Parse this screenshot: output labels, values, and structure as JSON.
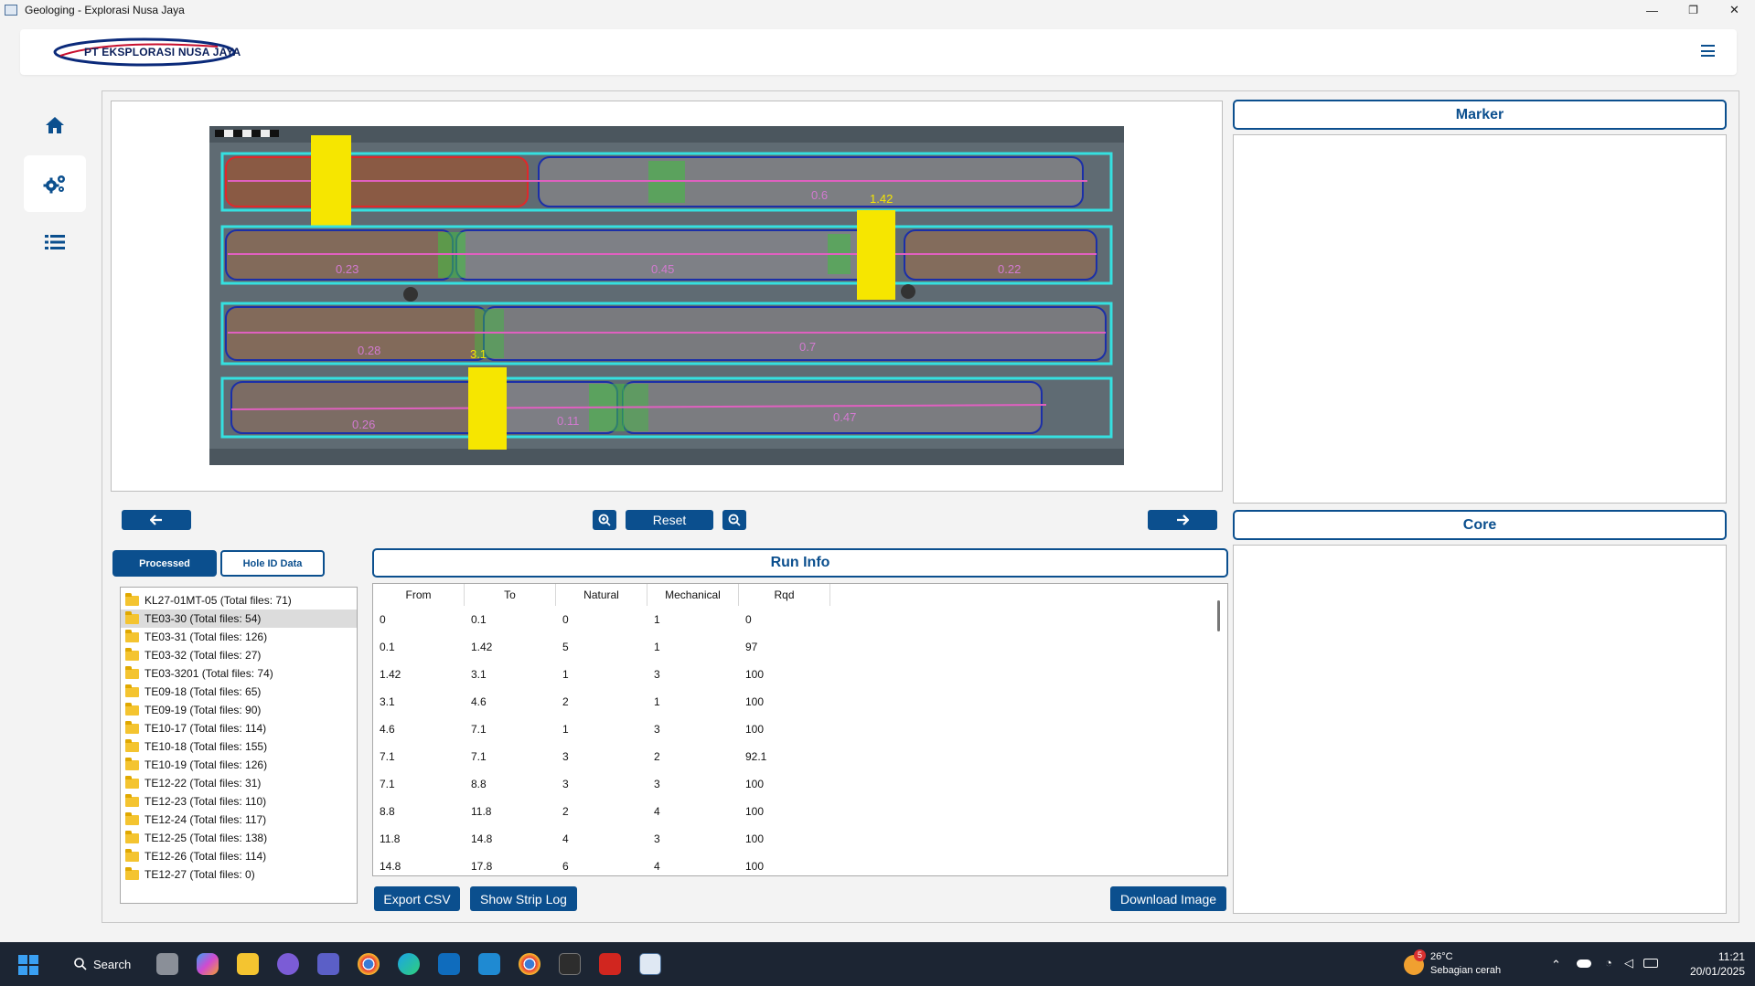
{
  "window": {
    "title": "Geologing - Explorasi Nusa Jaya",
    "minimize": "—",
    "restore": "❐",
    "close": "✕"
  },
  "header": {
    "logo_text": "PT EKSPLORASI NUSA JAYA",
    "menu_icon": "hamburger-icon"
  },
  "nav": {
    "items": [
      {
        "name": "home",
        "icon": "home-icon"
      },
      {
        "name": "settings",
        "icon": "gears-icon"
      },
      {
        "name": "list",
        "icon": "list-icon"
      }
    ],
    "active": "settings"
  },
  "core_image": {
    "labels": {
      "row1": [
        "0.6",
        "1.42"
      ],
      "row2": [
        "0.23",
        "0.45",
        "0.22"
      ],
      "row3": [
        "0.28",
        "0.7",
        "3.1"
      ],
      "row4": [
        "0.26",
        "0.11",
        "0.47"
      ]
    }
  },
  "controls": {
    "prev_icon": "arrow-left-icon",
    "next_icon": "arrow-right-icon",
    "zoom_in_icon": "zoom-in-icon",
    "zoom_out_icon": "zoom-out-icon",
    "reset_label": "Reset"
  },
  "tabs": {
    "processed": "Processed",
    "hole_id": "Hole ID Data"
  },
  "files": [
    "KL27-01MT-05 (Total files: 71)",
    "TE03-30 (Total files: 54)",
    "TE03-31 (Total files: 126)",
    "TE03-32 (Total files: 27)",
    "TE03-3201 (Total files: 74)",
    "TE09-18 (Total files: 65)",
    "TE09-19 (Total files: 90)",
    "TE10-17 (Total files: 114)",
    "TE10-18 (Total files: 155)",
    "TE10-19 (Total files: 126)",
    "TE12-22 (Total files: 31)",
    "TE12-23 (Total files: 110)",
    "TE12-24 (Total files: 117)",
    "TE12-25 (Total files: 138)",
    "TE12-26 (Total files: 114)",
    "TE12-27 (Total files: 0)"
  ],
  "selected_file": "TE03-30 (Total files: 54)",
  "run_info": {
    "title": "Run Info",
    "columns": [
      "From",
      "To",
      "Natural",
      "Mechanical",
      "Rqd"
    ],
    "rows": [
      [
        "0",
        "0.1",
        "0",
        "1",
        "0"
      ],
      [
        "0.1",
        "1.42",
        "5",
        "1",
        "97"
      ],
      [
        "1.42",
        "3.1",
        "1",
        "3",
        "100"
      ],
      [
        "3.1",
        "4.6",
        "2",
        "1",
        "100"
      ],
      [
        "4.6",
        "7.1",
        "1",
        "3",
        "100"
      ],
      [
        "7.1",
        "7.1",
        "3",
        "2",
        "92.1"
      ],
      [
        "7.1",
        "8.8",
        "3",
        "3",
        "100"
      ],
      [
        "8.8",
        "11.8",
        "2",
        "4",
        "100"
      ],
      [
        "11.8",
        "14.8",
        "4",
        "3",
        "100"
      ],
      [
        "14.8",
        "17.8",
        "6",
        "4",
        "100"
      ]
    ]
  },
  "buttons": {
    "export_csv": "Export CSV",
    "show_strip_log": "Show Strip Log",
    "download_image": "Download Image"
  },
  "right": {
    "marker_title": "Marker",
    "core_title": "Core"
  },
  "taskbar": {
    "search_label": "Search",
    "weather_temp": "26°C",
    "weather_desc": "Sebagian cerah",
    "weather_badge": "5",
    "time": "11:21",
    "date": "20/01/2025"
  },
  "colors": {
    "primary": "#0b4f8e",
    "background": "#f3f3f3",
    "taskbar": "#1c2533"
  }
}
